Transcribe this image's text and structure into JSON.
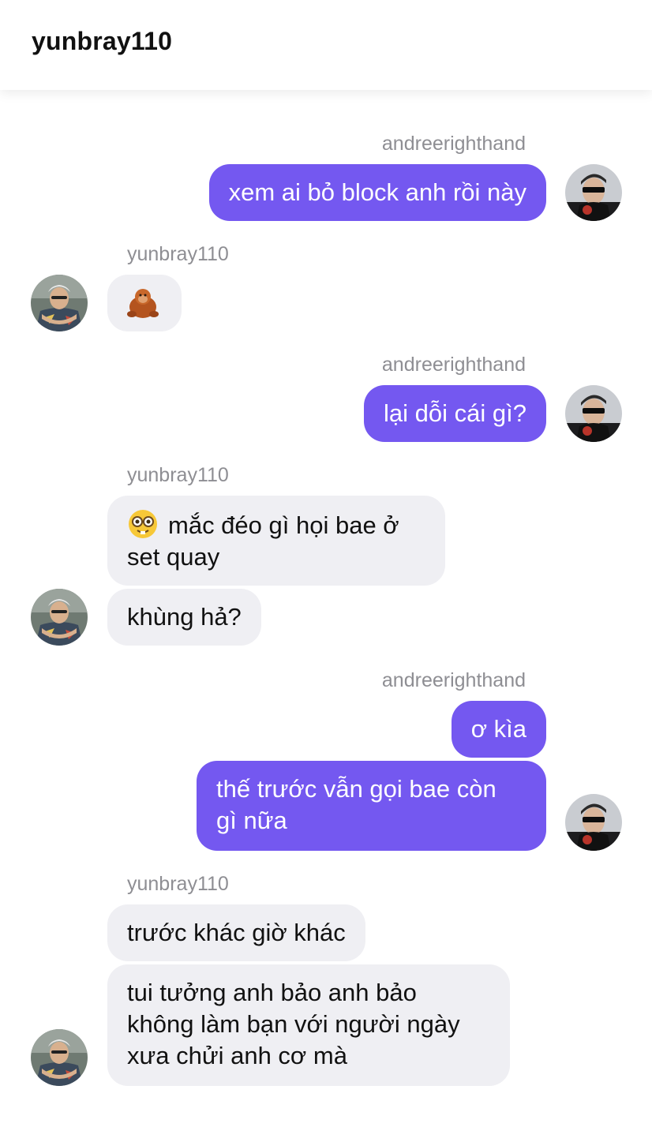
{
  "header": {
    "title": "yunbray110"
  },
  "users": {
    "me": "andreerighthand",
    "other": "yunbray110"
  },
  "messages": [
    {
      "sender": "andreerighthand",
      "text": "xem ai bỏ block anh rồi này"
    },
    {
      "sender": "yunbray110",
      "emoji": "orangutan"
    },
    {
      "sender": "andreerighthand",
      "text": "lại dỗi cái gì?"
    },
    {
      "sender": "yunbray110",
      "emoji": "nerd-face",
      "text": "mắc đéo gì họi bae ở set quay",
      "line1": "mắc đéo gì họi bae ở",
      "line2": "set quay"
    },
    {
      "sender": "yunbray110",
      "text": "khùng hả?"
    },
    {
      "sender": "andreerighthand",
      "text": "ơ kìa"
    },
    {
      "sender": "andreerighthand",
      "text": "thế trước vẫn gọi bae còn gì nữa",
      "line1": "thế trước vẫn gọi bae còn",
      "line2": "gì nữa"
    },
    {
      "sender": "yunbray110",
      "text": "trước khác giờ khác"
    },
    {
      "sender": "yunbray110",
      "text": "tui tưởng anh bảo anh bảo không làm bạn với người ngày xưa chửi anh cơ mà",
      "line1": "tui tưởng anh bảo anh bảo",
      "line2": "không làm bạn với người ngày",
      "line3": "xưa chửi anh cơ mà"
    }
  ],
  "colors": {
    "outgoing_bubble": "#7458f0",
    "incoming_bubble": "#efeff3",
    "sender_label": "#8e8e93"
  }
}
